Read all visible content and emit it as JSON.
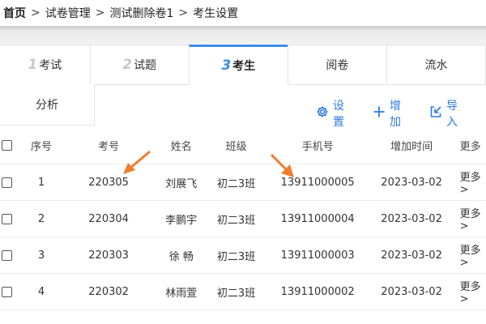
{
  "breadcrumb": {
    "home": "首页",
    "separator": ">",
    "items": [
      "试卷管理",
      "测试删除卷1",
      "考生设置"
    ]
  },
  "tabs": [
    {
      "num": "1",
      "label": "考试",
      "active": false
    },
    {
      "num": "2",
      "label": "试题",
      "active": false
    },
    {
      "num": "3",
      "label": "考生",
      "active": true
    },
    {
      "num": "",
      "label": "阅卷",
      "active": false
    },
    {
      "num": "",
      "label": "流水",
      "active": false
    }
  ],
  "tab_row2": {
    "label": "分析"
  },
  "actions": {
    "settings": "设置",
    "add": "增加",
    "import": "导入"
  },
  "colors": {
    "accent": "#2d7be0",
    "annotation_arrow": "#f07c2e"
  },
  "table": {
    "headers": {
      "seq": "序号",
      "id": "考号",
      "name": "姓名",
      "class": "班级",
      "phone": "手机号",
      "time": "增加时间",
      "more": "更多"
    },
    "rows": [
      {
        "seq": "1",
        "id": "220305",
        "name": "刘展飞",
        "class": "初二3班",
        "phone": "13911000005",
        "time": "2023-03-02",
        "more": "更多>"
      },
      {
        "seq": "2",
        "id": "220304",
        "name": "李鹏宇",
        "class": "初二3班",
        "phone": "13911000004",
        "time": "2023-03-02",
        "more": "更多>"
      },
      {
        "seq": "3",
        "id": "220303",
        "name": "徐 畅",
        "class": "初二3班",
        "phone": "13911000003",
        "time": "2023-03-02",
        "more": "更多>"
      },
      {
        "seq": "4",
        "id": "220302",
        "name": "林雨萱",
        "class": "初二3班",
        "phone": "13911000002",
        "time": "2023-03-02",
        "more": "更多>"
      }
    ]
  }
}
